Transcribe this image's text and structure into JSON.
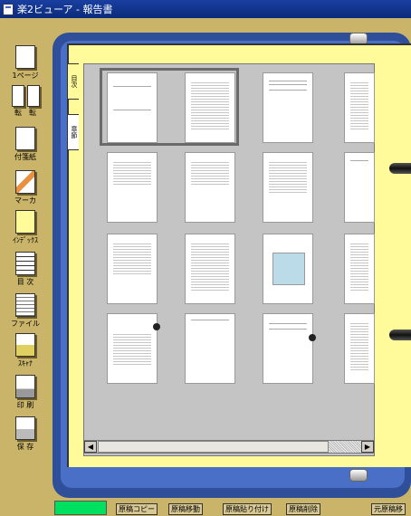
{
  "window": {
    "title": "楽2ビューア - 報告書"
  },
  "toolbar": {
    "one_page": "1ページ",
    "rotate_left": "転",
    "rotate_right": "転",
    "sticky": "付箋紙",
    "marker": "マーカ",
    "index": "ｲﾝﾃﾞｯｸｽ",
    "toc": "目 次",
    "file": "ファイル",
    "scanner": "ｽｷｬﾅ",
    "print": "印 刷",
    "save": "保 存"
  },
  "tabs": {
    "toc": "目次",
    "section": "章節"
  },
  "bottom": {
    "copy": "原稿コピー",
    "move": "原稿移動",
    "paste": "原稿貼り付け",
    "delete": "原稿削除",
    "restore": "元原稿移"
  },
  "colors": {
    "binder": "#2f4f9a",
    "page": "#fffb9a",
    "status": "#00e060"
  }
}
